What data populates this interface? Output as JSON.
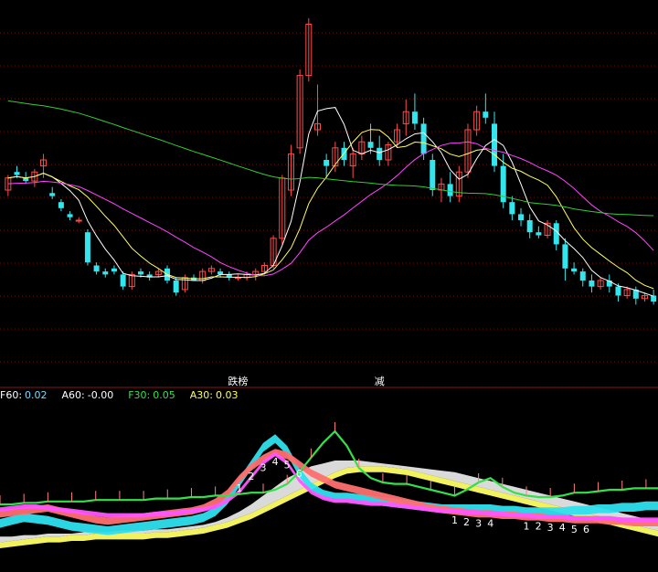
{
  "indicator_legend": [
    {
      "label": "F60:",
      "value": "0.02",
      "color": "#ffffff",
      "valueColor": "#7fd8ff"
    },
    {
      "label": "A60:",
      "value": "-0.00",
      "color": "#ffffff",
      "valueColor": "#ffffff"
    },
    {
      "label": "F30:",
      "value": "0.05",
      "color": "#33e04a",
      "valueColor": "#33e04a"
    },
    {
      "label": "A30:",
      "value": "0.03",
      "color": "#ffff55",
      "valueColor": "#ffff55"
    }
  ],
  "signal_labels": [
    {
      "text": "跌榜",
      "index": 26,
      "color": "#ffffff"
    },
    {
      "text": "减",
      "index": 42,
      "color": "#ffffff"
    }
  ],
  "chart_data": [
    {
      "type": "candlestick",
      "note_colors": {
        "up": "#ff4b4b",
        "down": "#33e6ee",
        "ma5": "#ffffff",
        "ma10": "#ffff66",
        "ma30": "#ff44ff",
        "ma60": "#33cc33"
      },
      "ylim": [
        0,
        100
      ],
      "candles": [
        [
          40,
          45,
          38,
          44
        ],
        [
          46,
          48,
          44,
          45
        ],
        [
          44,
          46,
          42,
          43
        ],
        [
          43,
          47,
          41,
          46
        ],
        [
          48,
          52,
          44,
          50
        ],
        [
          39,
          41,
          37,
          38
        ],
        [
          36,
          37,
          33,
          34
        ],
        [
          32,
          33,
          30,
          31
        ],
        [
          30,
          31,
          29,
          30
        ],
        [
          26,
          27,
          15,
          16
        ],
        [
          15,
          16,
          12,
          13
        ],
        [
          13,
          14,
          11,
          12
        ],
        [
          14,
          15,
          12,
          13
        ],
        [
          12,
          13,
          7,
          8
        ],
        [
          8,
          13,
          7,
          12
        ],
        [
          13,
          14,
          11,
          12
        ],
        [
          12,
          13,
          10,
          11
        ],
        [
          12,
          14,
          11,
          13
        ],
        [
          14,
          15,
          9,
          10
        ],
        [
          10,
          11,
          5,
          6
        ],
        [
          7,
          12,
          6,
          11
        ],
        [
          11,
          12,
          10,
          10
        ],
        [
          10,
          14,
          9,
          13
        ],
        [
          13,
          15,
          12,
          14
        ],
        [
          13,
          14,
          11,
          12
        ],
        [
          12,
          13,
          10,
          11
        ],
        [
          11,
          12,
          10,
          11
        ],
        [
          11,
          13,
          10,
          12
        ],
        [
          12,
          14,
          10,
          13
        ],
        [
          13,
          16,
          12,
          15
        ],
        [
          15,
          25,
          14,
          24
        ],
        [
          24,
          45,
          22,
          44
        ],
        [
          40,
          55,
          38,
          52
        ],
        [
          54,
          80,
          52,
          78
        ],
        [
          78,
          97,
          76,
          95
        ],
        [
          60,
          75,
          58,
          62
        ],
        [
          50,
          52,
          44,
          48
        ],
        [
          48,
          56,
          46,
          54
        ],
        [
          54,
          56,
          48,
          50
        ],
        [
          48,
          54,
          44,
          52
        ],
        [
          52,
          58,
          50,
          56
        ],
        [
          56,
          62,
          52,
          54
        ],
        [
          54,
          58,
          48,
          50
        ],
        [
          50,
          56,
          48,
          55
        ],
        [
          56,
          62,
          54,
          60
        ],
        [
          62,
          70,
          58,
          66
        ],
        [
          66,
          72,
          60,
          62
        ],
        [
          62,
          64,
          50,
          52
        ],
        [
          50,
          52,
          38,
          40
        ],
        [
          40,
          44,
          36,
          42
        ],
        [
          42,
          46,
          36,
          38
        ],
        [
          38,
          48,
          36,
          46
        ],
        [
          46,
          62,
          44,
          60
        ],
        [
          60,
          68,
          58,
          66
        ],
        [
          66,
          72,
          62,
          64
        ],
        [
          62,
          66,
          46,
          48
        ],
        [
          48,
          52,
          34,
          36
        ],
        [
          36,
          38,
          30,
          32
        ],
        [
          32,
          34,
          28,
          30
        ],
        [
          30,
          32,
          24,
          26
        ],
        [
          26,
          28,
          24,
          25
        ],
        [
          25,
          30,
          24,
          29
        ],
        [
          29,
          30,
          20,
          22
        ],
        [
          22,
          24,
          10,
          14
        ],
        [
          14,
          16,
          12,
          13
        ],
        [
          13,
          14,
          8,
          10
        ],
        [
          10,
          12,
          6,
          8
        ],
        [
          8,
          11,
          7,
          10
        ],
        [
          10,
          12,
          6,
          8
        ],
        [
          8,
          9,
          3,
          5
        ],
        [
          5,
          8,
          4,
          7
        ],
        [
          7,
          8,
          2,
          4
        ],
        [
          4,
          6,
          3,
          5
        ],
        [
          5,
          7,
          2,
          3
        ]
      ]
    },
    {
      "type": "area",
      "series": [
        {
          "name": "F60",
          "color": "#ffffff"
        },
        {
          "name": "A60",
          "color": "#ffffff"
        },
        {
          "name": "F30",
          "color": "#33e04a"
        },
        {
          "name": "A30",
          "color": "#ffff55"
        }
      ],
      "values": {
        "green": [
          30,
          30,
          31,
          31,
          32,
          32,
          32,
          32,
          33,
          33,
          33,
          33,
          33,
          34,
          34,
          34,
          35,
          35,
          36,
          36,
          37,
          38,
          38,
          40,
          44,
          52,
          62,
          72,
          80,
          70,
          55,
          48,
          45,
          44,
          44,
          42,
          40,
          38,
          36,
          40,
          45,
          48,
          42,
          38,
          36,
          35,
          35,
          36,
          38,
          38,
          39,
          40,
          40,
          41,
          41,
          41
        ],
        "cyan": [
          20,
          22,
          24,
          23,
          22,
          20,
          18,
          17,
          16,
          15,
          16,
          17,
          18,
          19,
          20,
          21,
          22,
          24,
          28,
          36,
          48,
          60,
          72,
          78,
          70,
          55,
          45,
          40,
          38,
          38,
          37,
          36,
          35,
          34,
          33,
          32,
          31,
          30,
          30,
          30,
          30,
          30,
          29,
          29,
          28,
          28,
          28,
          28,
          29,
          29,
          30,
          30,
          31,
          31,
          32,
          32
        ],
        "white": [
          8,
          8,
          9,
          9,
          10,
          10,
          10,
          11,
          11,
          11,
          12,
          12,
          12,
          13,
          13,
          14,
          15,
          16,
          18,
          21,
          25,
          30,
          36,
          42,
          48,
          52,
          56,
          58,
          60,
          60,
          60,
          59,
          58,
          57,
          56,
          55,
          54,
          53,
          52,
          50,
          48,
          46,
          44,
          42,
          40,
          38,
          36,
          34,
          32,
          30,
          28,
          26,
          24,
          22,
          20,
          18
        ],
        "yellow": [
          4,
          5,
          6,
          7,
          8,
          8,
          9,
          9,
          10,
          10,
          10,
          10,
          10,
          11,
          11,
          12,
          13,
          14,
          16,
          18,
          21,
          24,
          28,
          32,
          36,
          40,
          44,
          48,
          52,
          55,
          56,
          56,
          56,
          55,
          54,
          52,
          50,
          48,
          46,
          44,
          42,
          40,
          38,
          36,
          34,
          32,
          30,
          28,
          26,
          24,
          22,
          20,
          18,
          16,
          14,
          12
        ],
        "red": [
          26,
          27,
          28,
          29,
          30,
          28,
          26,
          24,
          22,
          21,
          22,
          23,
          24,
          25,
          26,
          27,
          28,
          30,
          34,
          40,
          50,
          58,
          64,
          68,
          66,
          60,
          54,
          50,
          46,
          44,
          42,
          40,
          38,
          36,
          34,
          32,
          30,
          29,
          28,
          27,
          26,
          26,
          25,
          25,
          24,
          24,
          23,
          23,
          22,
          22,
          22,
          21,
          21,
          20,
          20,
          20
        ],
        "magenta": [
          28,
          29,
          30,
          30,
          29,
          28,
          27,
          26,
          25,
          24,
          24,
          24,
          24,
          25,
          25,
          26,
          27,
          28,
          30,
          34,
          40,
          50,
          60,
          66,
          60,
          48,
          40,
          36,
          34,
          34,
          33,
          32,
          32,
          31,
          30,
          29,
          28,
          27,
          27,
          26,
          26,
          25,
          25,
          24,
          24,
          23,
          23,
          23,
          22,
          22,
          22,
          22,
          21,
          21,
          21,
          21
        ]
      },
      "digits": [
        {
          "index": 20,
          "text": "1"
        },
        {
          "index": 21,
          "text": "2"
        },
        {
          "index": 22,
          "text": "3"
        },
        {
          "index": 23,
          "text": "4"
        },
        {
          "index": 24,
          "text": "5"
        },
        {
          "index": 25,
          "text": "6"
        },
        {
          "index": 38,
          "text": "1"
        },
        {
          "index": 39,
          "text": "2"
        },
        {
          "index": 40,
          "text": "3"
        },
        {
          "index": 41,
          "text": "4"
        },
        {
          "index": 44,
          "text": "1"
        },
        {
          "index": 45,
          "text": "2"
        },
        {
          "index": 46,
          "text": "3"
        },
        {
          "index": 47,
          "text": "4"
        },
        {
          "index": 48,
          "text": "5"
        },
        {
          "index": 49,
          "text": "6"
        }
      ]
    }
  ]
}
